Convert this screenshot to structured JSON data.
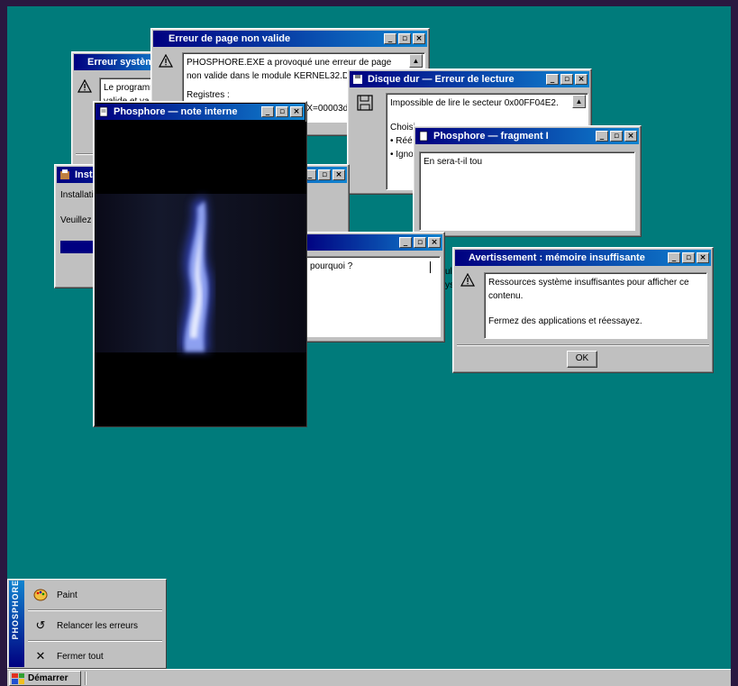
{
  "windows": {
    "erreur_systeme": {
      "title": "Erreur système",
      "text": "Le programme valide et va"
    },
    "page_non_valide": {
      "title": "Erreur de page non valide",
      "text": "PHOSPHORE.EXE a provoqué une erreur de page non valide dans le module KERNEL32.DLL à 0",
      "text2": "Registres :",
      "text3": "EAX=00003d7ef"
    },
    "disque_dur": {
      "title": "Disque dur — Erreur de lecture",
      "text": "Impossible de lire le secteur 0x00FF04E2.",
      "text2": "Choisi",
      "text3": "• Réé",
      "text4": "• Igno"
    },
    "installation": {
      "title": "Insta",
      "line1": "Installati",
      "line2": "Veuillez p"
    },
    "note_interne": {
      "title": "Phosphore — note interne"
    },
    "fragment": {
      "title": "Phosphore — fragment I",
      "text": "En sera-t-il tou"
    },
    "pourquoi": {
      "text": "pourquoi ?",
      "side": "ul\nys"
    },
    "memoire": {
      "title": "Avertissement : mémoire insuffisante",
      "line1": "Ressources système insuffisantes pour afficher ce contenu.",
      "line2": "Fermez des applications et réessayez.",
      "ok": "OK"
    }
  },
  "start_menu": {
    "band": "PHOSPHORE",
    "items": [
      {
        "label": "Paint",
        "icon": "palette-icon"
      },
      {
        "label": "Relancer les erreurs",
        "icon": "reload-icon"
      },
      {
        "label": "Fermer tout",
        "icon": "close-icon"
      }
    ]
  },
  "taskbar": {
    "start_label": "Démarrer"
  },
  "colors": {
    "desktop": "#007b7b",
    "titlebar_start": "#000080",
    "titlebar_end": "#1084d0"
  }
}
